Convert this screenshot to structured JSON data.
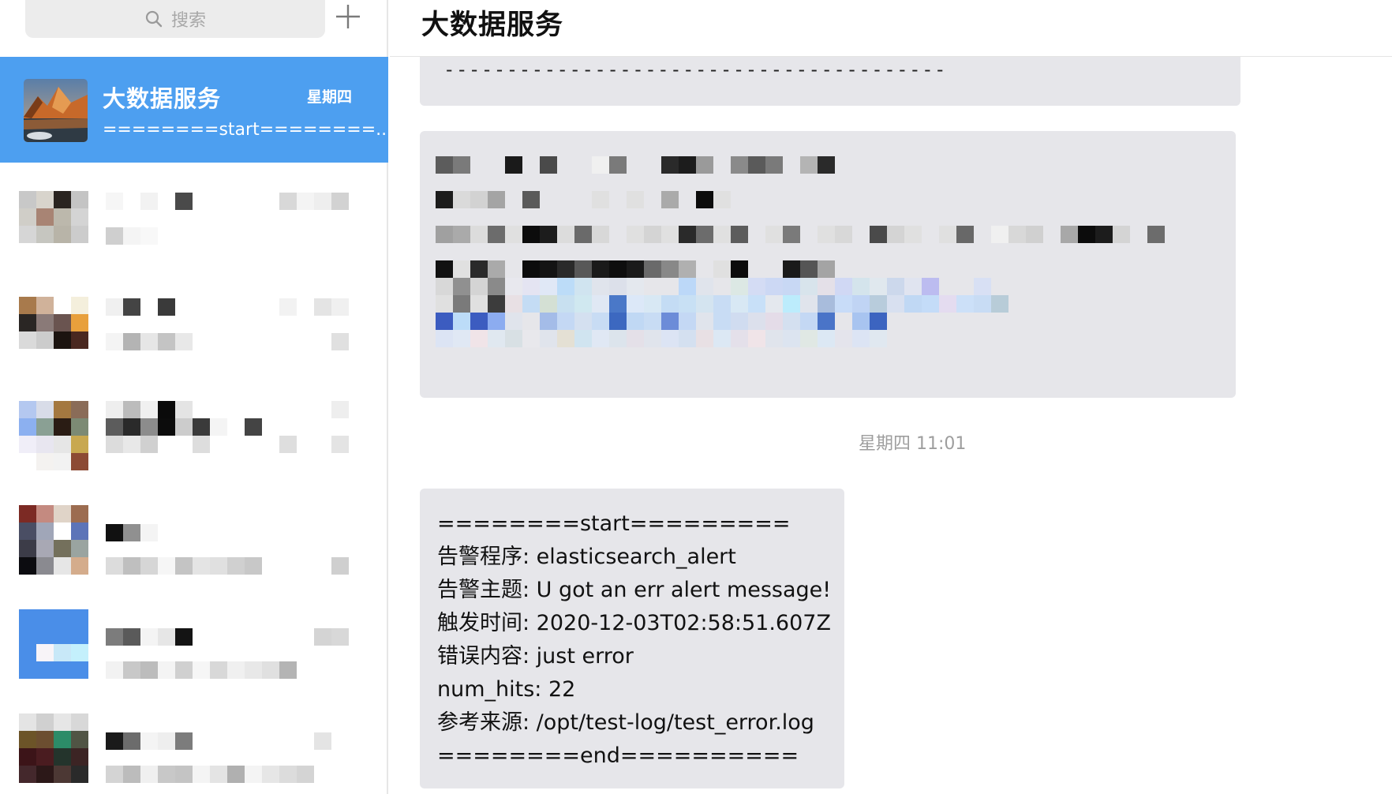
{
  "search": {
    "placeholder": "搜索"
  },
  "icons": {
    "search": "search-icon",
    "add": "plus-icon"
  },
  "active_chat": {
    "name": "大数据服务",
    "date": "星期四",
    "preview": "========start========..."
  },
  "chat_header": {
    "title": "大数据服务"
  },
  "top_bubble": {
    "text": "----------------------------------------"
  },
  "message": {
    "time": "星期四 11:01",
    "lines": [
      "========start=========",
      "告警程序: elasticsearch_alert",
      "告警主题: U got an err alert message!",
      "触发时间: 2020-12-03T02:58:51.607Z",
      "错误内容: just error",
      "num_hits: 22",
      "参考来源: /opt/test-log/test_error.log",
      "========end=========="
    ]
  },
  "colors": {
    "active_item": "#4d9ff0",
    "bubble": "#e6e6ea",
    "time_text": "#9e9e9e"
  }
}
